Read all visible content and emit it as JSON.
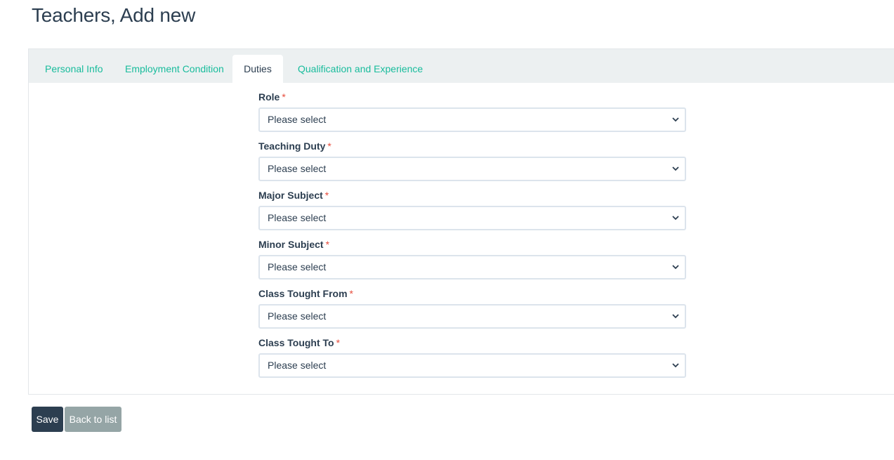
{
  "page": {
    "title": "Teachers, Add new"
  },
  "tabs": [
    {
      "label": "Personal Info",
      "active": false
    },
    {
      "label": "Employment Condition",
      "active": false
    },
    {
      "label": "Duties",
      "active": true
    },
    {
      "label": "Qualification and Experience",
      "active": false
    }
  ],
  "form": {
    "required_marker": "*",
    "fields": [
      {
        "label": "Role",
        "value": "Please select"
      },
      {
        "label": "Teaching Duty",
        "value": "Please select"
      },
      {
        "label": "Major Subject",
        "value": "Please select"
      },
      {
        "label": "Minor Subject",
        "value": "Please select"
      },
      {
        "label": "Class Tought From",
        "value": "Please select"
      },
      {
        "label": "Class Tought To",
        "value": "Please select"
      }
    ]
  },
  "actions": {
    "save_label": "Save",
    "back_label": "Back to list"
  },
  "colors": {
    "accent": "#18bc9c",
    "primary": "#2c3e50",
    "secondary": "#95a5a6",
    "required": "#e74c3c",
    "tab_bar_bg": "#ecf0f1"
  }
}
